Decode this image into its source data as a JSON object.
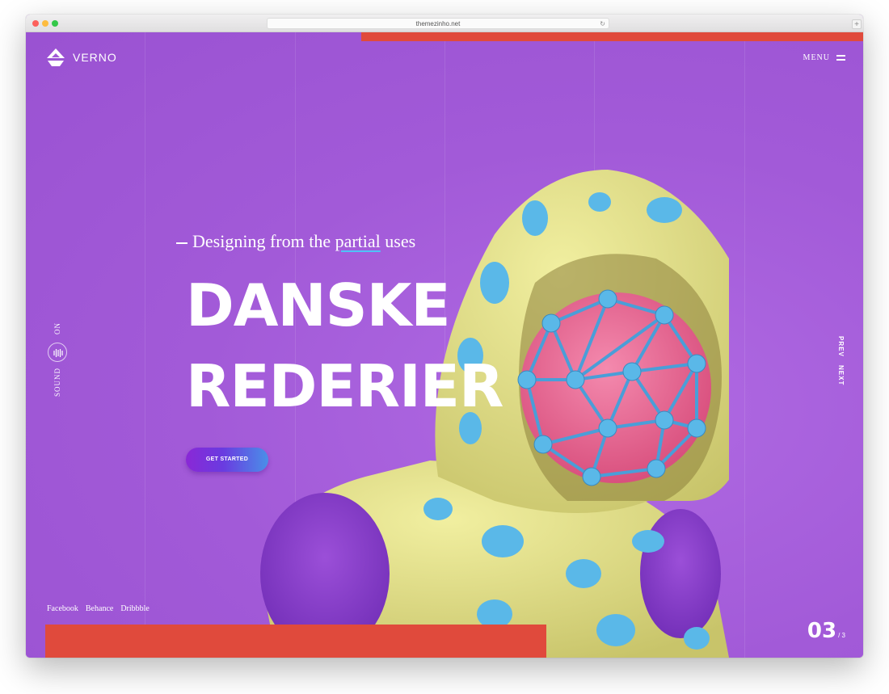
{
  "browser": {
    "url": "themezinho.net",
    "reload_icon": "reload-icon",
    "new_tab_icon": "plus-icon"
  },
  "header": {
    "logo_text": "VERNO",
    "logo_icon": "verno-logo-icon",
    "menu_label": "MENU",
    "menu_icon": "hamburger-icon"
  },
  "hero": {
    "subtitle_before": "Designing from the ",
    "subtitle_highlight": "partial",
    "subtitle_after": " uses",
    "title_line1": "DANSKE",
    "title_line2": "REDERIER",
    "cta_label": "GET STARTED"
  },
  "sound": {
    "state_label": "ON",
    "label": "SOUND",
    "icon": "sound-wave-icon"
  },
  "pager": {
    "prev_label": "PREV",
    "next_label": "NEXT"
  },
  "social": {
    "links": [
      "Facebook",
      "Behance",
      "Dribbble"
    ]
  },
  "slider": {
    "current": "03",
    "total": "/ 3"
  },
  "colors": {
    "background": "#a25ad8",
    "accent_red": "#e04a3c",
    "hood_yellow": "#e6e38a",
    "dots_blue": "#5ab8e8",
    "face_pink": "#ea6e98",
    "cta_gradient_start": "#8a28d6",
    "cta_gradient_end": "#4a8fe8"
  }
}
